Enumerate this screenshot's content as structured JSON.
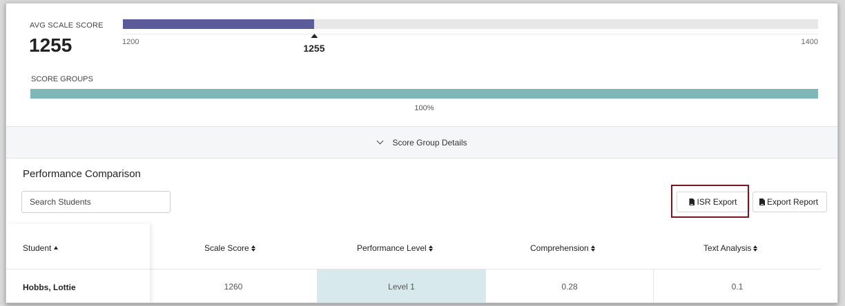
{
  "scale": {
    "label": "AVG SCALE SCORE",
    "value": "1255",
    "min_label": "1200",
    "max_label": "1400",
    "marker_label": "1255",
    "min": 1200,
    "max": 1400,
    "score": 1255,
    "fill_color": "#5b5b9b"
  },
  "score_groups": {
    "label": "SCORE GROUPS",
    "percent_label": "100%",
    "percent": 100,
    "bar_color": "#7fb7b9"
  },
  "details_toggle": {
    "label": "Score Group Details",
    "icon": "chevron-down-icon"
  },
  "performance": {
    "title": "Performance Comparison",
    "search_placeholder": "Search Students",
    "isr_export_label": "ISR Export",
    "export_report_label": "Export Report",
    "file_icon": "file-download-icon",
    "highlight_color": "#7a1520"
  },
  "table": {
    "headers": [
      "Student",
      "Scale Score",
      "Performance Level",
      "Comprehension",
      "Text Analysis"
    ],
    "rows": [
      {
        "student": "Hobbs, Lottie",
        "scale_score": "1260",
        "performance_level": "Level 1",
        "comprehension": "0.28",
        "text_analysis": "0.1"
      }
    ],
    "level_cell_color": "#d8e9ed"
  }
}
